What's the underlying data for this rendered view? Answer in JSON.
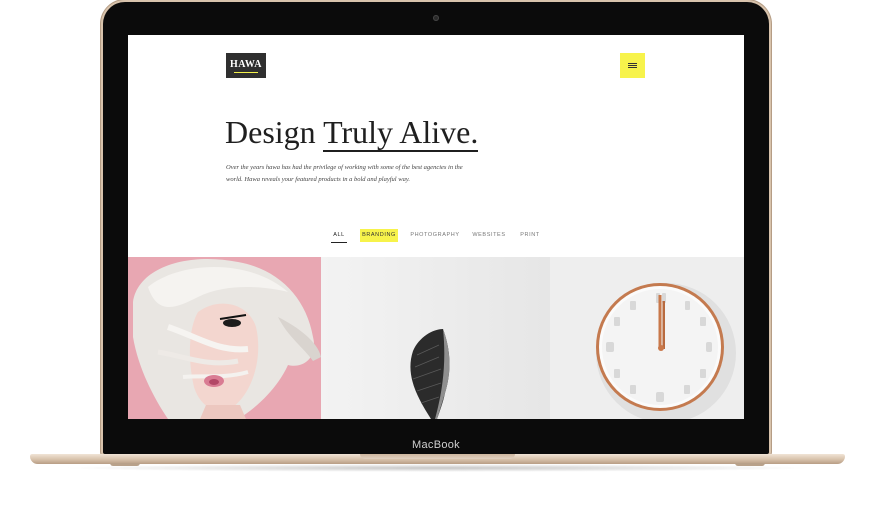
{
  "device": {
    "brand_label": "MacBook"
  },
  "site": {
    "logo_text": "HAWA",
    "headline_plain": "Design ",
    "headline_underlined": "Truly Alive.",
    "intro_text": "Over the years hawa has had the privilege of working with some of the best agencies in the world. Hawa reveals your featured products in a bold and playful way.",
    "filters": [
      "ALL",
      "BRANDING",
      "PHOTOGRAPHY",
      "WEBSITES",
      "PRINT"
    ],
    "active_filter": "ALL",
    "highlighted_filter": "BRANDING"
  },
  "portfolio": {
    "items": [
      {
        "subject": "portrait of woman with platinum hair on pink background"
      },
      {
        "subject": "black feather on white background"
      },
      {
        "subject": "white wall clock with copper rim"
      }
    ]
  },
  "colors": {
    "accent_yellow": "#f7f34b",
    "logo_bg": "#2f2f2f",
    "frame_gold": "#d8c3ac",
    "pink_bg": "#e7a5b0"
  },
  "icons": [
    "hamburger-menu-icon",
    "camera-icon"
  ]
}
